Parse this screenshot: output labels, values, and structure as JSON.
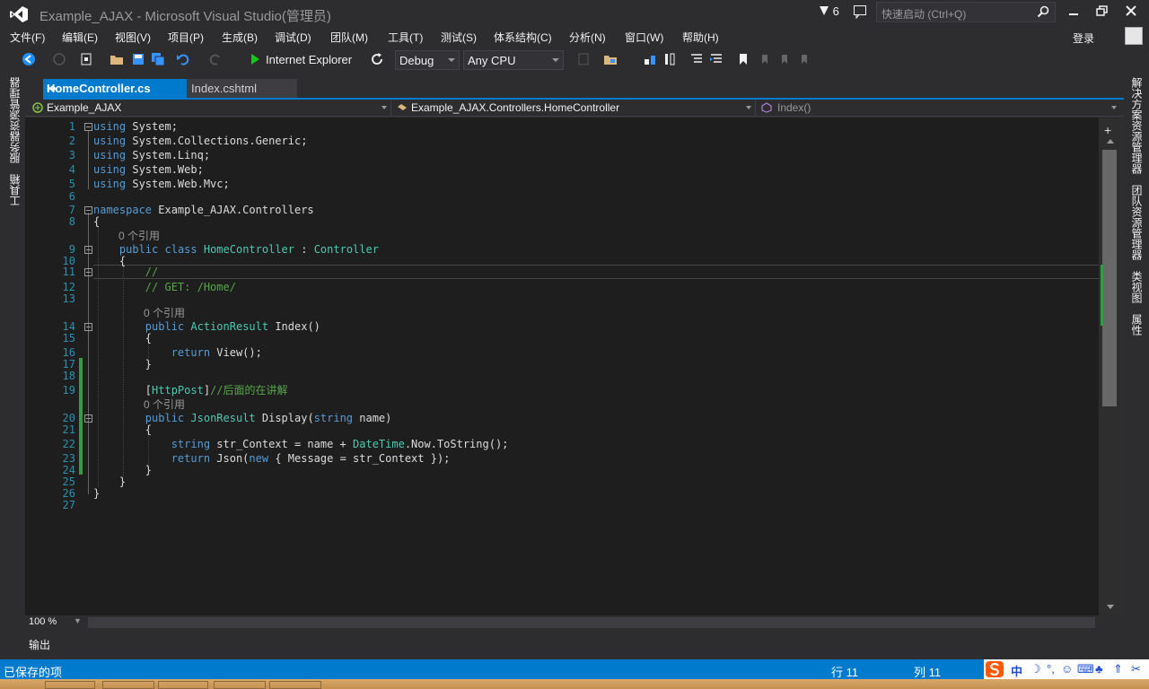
{
  "window": {
    "title": "Example_AJAX - Microsoft Visual Studio(管理员)",
    "notification_count": "6",
    "quick_launch_placeholder": "快速启动 (Ctrl+Q)"
  },
  "menu": [
    "文件(F)",
    "编辑(E)",
    "视图(V)",
    "项目(P)",
    "生成(B)",
    "调试(D)",
    "团队(M)",
    "工具(T)",
    "测试(S)",
    "体系结构(C)",
    "分析(N)",
    "窗口(W)",
    "帮助(H)"
  ],
  "signin_label": "登录",
  "toolbar": {
    "run_target": "Internet Explorer",
    "configuration": "Debug",
    "platform": "Any CPU"
  },
  "left_tabs": [
    "服务器资源管理器",
    "工具箱"
  ],
  "right_tabs": [
    "解决方案资源管理器",
    "团队资源管理器",
    "类视图",
    "属性"
  ],
  "tabs": {
    "active": "HomeController.cs",
    "inactive": "Index.cshtml"
  },
  "navigation": {
    "project": "Example_AJAX",
    "type": "Example_AJAX.Controllers.HomeController",
    "member": "Index()"
  },
  "editor": {
    "codelens": "0 个引用",
    "lines": [
      {
        "n": "1",
        "tokens": [
          [
            "kw",
            "using"
          ],
          [
            "p",
            " System;"
          ]
        ]
      },
      {
        "n": "2",
        "tokens": [
          [
            "kw",
            "using"
          ],
          [
            "p",
            " System.Collections.Generic;"
          ]
        ]
      },
      {
        "n": "3",
        "tokens": [
          [
            "kw",
            "using"
          ],
          [
            "p",
            " System.Linq;"
          ]
        ]
      },
      {
        "n": "4",
        "tokens": [
          [
            "kw",
            "using"
          ],
          [
            "p",
            " System.Web;"
          ]
        ]
      },
      {
        "n": "5",
        "tokens": [
          [
            "kw",
            "using"
          ],
          [
            "p",
            " System.Web.Mvc;"
          ]
        ]
      },
      {
        "n": "6",
        "tokens": []
      },
      {
        "n": "7",
        "tokens": [
          [
            "kw",
            "namespace"
          ],
          [
            "p",
            " Example_AJAX.Controllers"
          ]
        ]
      },
      {
        "n": "8",
        "tokens": [
          [
            "p",
            "{"
          ]
        ]
      },
      {
        "n": "9",
        "tokens": [
          [
            "p",
            "    "
          ],
          [
            "kw",
            "public"
          ],
          [
            "p",
            " "
          ],
          [
            "kw",
            "class"
          ],
          [
            "p",
            " "
          ],
          [
            "ty",
            "HomeController"
          ],
          [
            "p",
            " : "
          ],
          [
            "ty",
            "Controller"
          ]
        ]
      },
      {
        "n": "10",
        "tokens": [
          [
            "p",
            "    {"
          ]
        ]
      },
      {
        "n": "11",
        "tokens": [
          [
            "p",
            "        "
          ],
          [
            "cm",
            "//"
          ]
        ]
      },
      {
        "n": "12",
        "tokens": [
          [
            "p",
            "        "
          ],
          [
            "cm",
            "// GET: /Home/"
          ]
        ]
      },
      {
        "n": "13",
        "tokens": []
      },
      {
        "n": "14",
        "tokens": [
          [
            "p",
            "        "
          ],
          [
            "kw",
            "public"
          ],
          [
            "p",
            " "
          ],
          [
            "ty",
            "ActionResult"
          ],
          [
            "p",
            " Index()"
          ]
        ]
      },
      {
        "n": "15",
        "tokens": [
          [
            "p",
            "        {"
          ]
        ]
      },
      {
        "n": "16",
        "tokens": [
          [
            "p",
            "            "
          ],
          [
            "kw",
            "return"
          ],
          [
            "p",
            " View();"
          ]
        ]
      },
      {
        "n": "17",
        "tokens": [
          [
            "p",
            "        }"
          ]
        ]
      },
      {
        "n": "18",
        "tokens": []
      },
      {
        "n": "19",
        "tokens": [
          [
            "p",
            "        ["
          ],
          [
            "ty",
            "HttpPost"
          ],
          [
            "p",
            "]"
          ],
          [
            "cm",
            "//后面的在讲解"
          ]
        ]
      },
      {
        "n": "20",
        "tokens": [
          [
            "p",
            "        "
          ],
          [
            "kw",
            "public"
          ],
          [
            "p",
            " "
          ],
          [
            "ty",
            "JsonResult"
          ],
          [
            "p",
            " Display("
          ],
          [
            "kw",
            "string"
          ],
          [
            "p",
            " name)"
          ]
        ]
      },
      {
        "n": "21",
        "tokens": [
          [
            "p",
            "        {"
          ]
        ]
      },
      {
        "n": "22",
        "tokens": [
          [
            "p",
            "            "
          ],
          [
            "kw",
            "string"
          ],
          [
            "p",
            " str_Context = name + "
          ],
          [
            "ty",
            "DateTime"
          ],
          [
            "p",
            ".Now.ToString();"
          ]
        ]
      },
      {
        "n": "23",
        "tokens": [
          [
            "p",
            "            "
          ],
          [
            "kw",
            "return"
          ],
          [
            "p",
            " Json("
          ],
          [
            "kw",
            "new"
          ],
          [
            "p",
            " { Message = str_Context });"
          ]
        ]
      },
      {
        "n": "24",
        "tokens": [
          [
            "p",
            "        }"
          ]
        ]
      },
      {
        "n": "25",
        "tokens": [
          [
            "p",
            "    }"
          ]
        ]
      },
      {
        "n": "26",
        "tokens": [
          [
            "p",
            "}"
          ]
        ]
      },
      {
        "n": "27",
        "tokens": []
      }
    ]
  },
  "zoom": "100 %",
  "output_label": "输出",
  "status": {
    "message": "已保存的项",
    "row": "行 11",
    "col": "列 11",
    "ime_mode": "中"
  },
  "colors": {
    "accent": "#007acc",
    "keyword": "#569cd6",
    "type": "#4ec9b0",
    "comment": "#57a64a",
    "line_number": "#2b91af",
    "change_marker": "#2ea043"
  }
}
